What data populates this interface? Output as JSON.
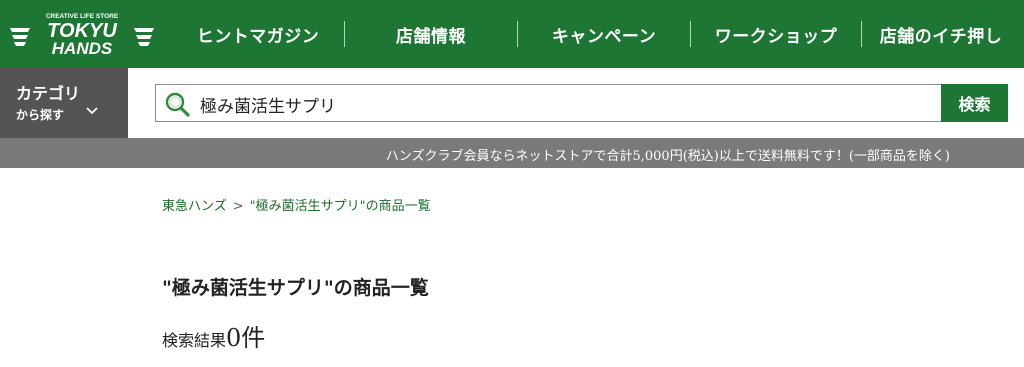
{
  "logo": {
    "tagline": "CREATIVE LIFE STORE",
    "line1": "TOKYU",
    "line2": "HANDS"
  },
  "nav": {
    "items": [
      "ヒントマガジン",
      "店舗情報",
      "キャンペーン",
      "ワークショップ",
      "店舗のイチ押し"
    ]
  },
  "category": {
    "title": "カテゴリ",
    "sub": "から探す",
    "icon": "chevron-down-icon"
  },
  "search": {
    "value": "極み菌活生サプリ",
    "button": "検索",
    "icon": "search-icon"
  },
  "notice": "ハンズクラブ会員ならネットストアで合計5,000円(税込)以上で送料無料です！(一部商品を除く)",
  "breadcrumb": {
    "home": "東急ハンズ",
    "separator": ">",
    "current": "\"極み菌活生サプリ\"の商品一覧"
  },
  "main": {
    "title": "\"極み菌活生サプリ\"の商品一覧",
    "results_label": "検索結果",
    "results_count": "0件"
  },
  "colors": {
    "brand_green": "#1e7634",
    "category_gray": "#545454",
    "notice_gray": "#7a7a7a"
  }
}
